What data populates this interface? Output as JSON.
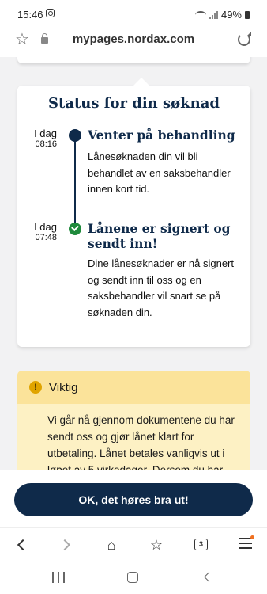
{
  "status_bar": {
    "time": "15:46",
    "battery": "49%"
  },
  "browser": {
    "url": "mypages.nordax.com",
    "tab_count": "3"
  },
  "status_card": {
    "title": "Status for din søknad",
    "events": [
      {
        "day": "I dag",
        "time": "08:16",
        "heading": "Venter på behandling",
        "text": "Lånesøknaden din vil bli behandlet av en saksbehandler innen kort tid."
      },
      {
        "day": "I dag",
        "time": "07:48",
        "heading": "Lånene er signert og sendt inn!",
        "text": "Dine lånesøknader er nå signert og sendt inn til oss og en saksbehandler vil snart se på søknaden din."
      }
    ]
  },
  "notice": {
    "title": "Viktig",
    "icon_text": "!",
    "text": "Vi går nå gjennom dokumentene du har sendt oss og gjør lånet klart for utbetaling. Lånet betales vanligvis ut i løpet av 5 virkedager. Dersom du har"
  },
  "primary_button": {
    "label": "OK, det høres bra ut!"
  },
  "colors": {
    "navy": "#0f2a4a",
    "green": "#1f8a3c",
    "warning_bg": "#fdf1c4",
    "warning_header": "#fbe39a"
  },
  "icons": [
    "instagram-icon",
    "wifi-icon",
    "signal-icon",
    "battery-icon",
    "star-icon",
    "lock-icon",
    "reload-icon",
    "back-icon",
    "forward-icon",
    "home-icon",
    "bookmarks-icon",
    "tabs-icon",
    "menu-icon"
  ]
}
